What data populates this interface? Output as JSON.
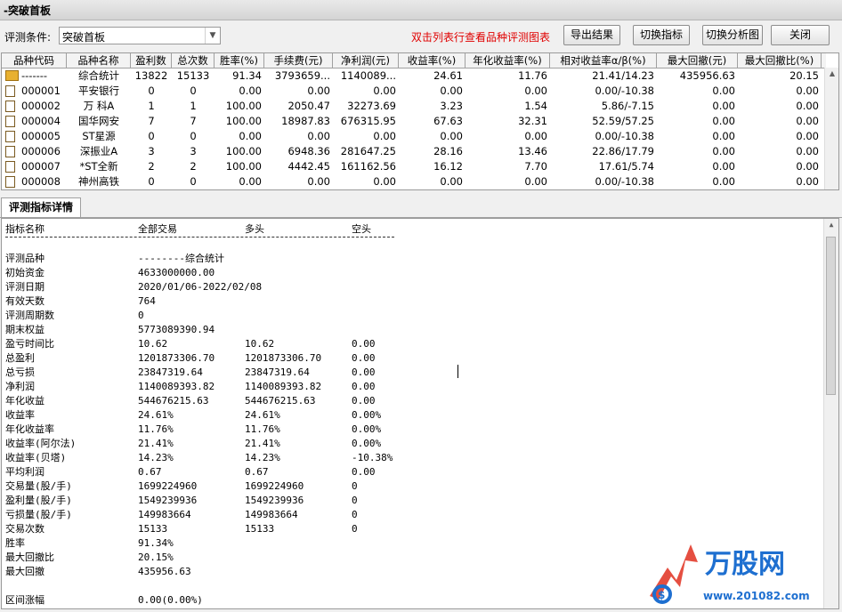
{
  "window": {
    "title": "-突破首板"
  },
  "toolbar": {
    "cond_label": "评测条件:",
    "cond_value": "突破首板",
    "hint": "双击列表行查看品种评测图表",
    "btn_export": "导出结果",
    "btn_switch_indicator": "切换指标",
    "btn_switch_chart": "切换分析图",
    "btn_close": "关闭"
  },
  "grid": {
    "headers": [
      "品种代码",
      "品种名称",
      "盈利数",
      "总次数",
      "胜率(%)",
      "手续费(元)",
      "净利润(元)",
      "收益率(%)",
      "年化收益率(%)",
      "相对收益率α/β(%)",
      "最大回撤(元)",
      "最大回撤比(%)"
    ],
    "rows": [
      {
        "icon": "folder-icon",
        "code": "-------",
        "name": "综合统计",
        "win": "13822",
        "total": "15133",
        "rate": "91.34",
        "fee": "3793659...",
        "profit": "1140089...",
        "ret": "24.61",
        "annual": "11.76",
        "ab": "21.41/14.23",
        "dd": "435956.63",
        "ddr": "20.15"
      },
      {
        "icon": "file-icon",
        "code": "000001",
        "name": "平安银行",
        "win": "0",
        "total": "0",
        "rate": "0.00",
        "fee": "0.00",
        "profit": "0.00",
        "ret": "0.00",
        "annual": "0.00",
        "ab": "0.00/-10.38",
        "dd": "0.00",
        "ddr": "0.00"
      },
      {
        "icon": "file-icon",
        "code": "000002",
        "name": "万 科A",
        "win": "1",
        "total": "1",
        "rate": "100.00",
        "fee": "2050.47",
        "profit": "32273.69",
        "ret": "3.23",
        "annual": "1.54",
        "ab": "5.86/-7.15",
        "dd": "0.00",
        "ddr": "0.00"
      },
      {
        "icon": "file-icon",
        "code": "000004",
        "name": "国华网安",
        "win": "7",
        "total": "7",
        "rate": "100.00",
        "fee": "18987.83",
        "profit": "676315.95",
        "ret": "67.63",
        "annual": "32.31",
        "ab": "52.59/57.25",
        "dd": "0.00",
        "ddr": "0.00"
      },
      {
        "icon": "file-icon",
        "code": "000005",
        "name": "ST星源",
        "win": "0",
        "total": "0",
        "rate": "0.00",
        "fee": "0.00",
        "profit": "0.00",
        "ret": "0.00",
        "annual": "0.00",
        "ab": "0.00/-10.38",
        "dd": "0.00",
        "ddr": "0.00"
      },
      {
        "icon": "file-icon",
        "code": "000006",
        "name": "深振业A",
        "win": "3",
        "total": "3",
        "rate": "100.00",
        "fee": "6948.36",
        "profit": "281647.25",
        "ret": "28.16",
        "annual": "13.46",
        "ab": "22.86/17.79",
        "dd": "0.00",
        "ddr": "0.00"
      },
      {
        "icon": "file-icon",
        "code": "000007",
        "name": "*ST全新",
        "win": "2",
        "total": "2",
        "rate": "100.00",
        "fee": "4442.45",
        "profit": "161162.56",
        "ret": "16.12",
        "annual": "7.70",
        "ab": "17.61/5.74",
        "dd": "0.00",
        "ddr": "0.00"
      },
      {
        "icon": "file-icon",
        "code": "000008",
        "name": "神州高铁",
        "win": "0",
        "total": "0",
        "rate": "0.00",
        "fee": "0.00",
        "profit": "0.00",
        "ret": "0.00",
        "annual": "0.00",
        "ab": "0.00/-10.38",
        "dd": "0.00",
        "ddr": "0.00"
      }
    ]
  },
  "detail": {
    "tab": "评测指标详情",
    "headers": [
      "指标名称",
      "全部交易",
      "多头",
      "空头"
    ],
    "rows": [
      {
        "name": "评测品种",
        "all": "--------综合统计",
        "long": "",
        "short": ""
      },
      {
        "name": "初始资金",
        "all": "4633000000.00",
        "long": "",
        "short": ""
      },
      {
        "name": "评测日期",
        "all": "2020/01/06-2022/02/08",
        "long": "",
        "short": ""
      },
      {
        "name": "有效天数",
        "all": "764",
        "long": "",
        "short": ""
      },
      {
        "name": "评测周期数",
        "all": "0",
        "long": "",
        "short": ""
      },
      {
        "name": "期末权益",
        "all": "5773089390.94",
        "long": "",
        "short": ""
      },
      {
        "name": "盈亏时间比",
        "all": "10.62",
        "long": "10.62",
        "short": "0.00"
      },
      {
        "name": "总盈利",
        "all": "1201873306.70",
        "long": "1201873306.70",
        "short": "0.00"
      },
      {
        "name": "总亏损",
        "all": "23847319.64",
        "long": "23847319.64",
        "short": "0.00"
      },
      {
        "name": "净利润",
        "all": "1140089393.82",
        "long": "1140089393.82",
        "short": "0.00"
      },
      {
        "name": "年化收益",
        "all": "544676215.63",
        "long": "544676215.63",
        "short": "0.00"
      },
      {
        "name": "收益率",
        "all": "24.61%",
        "long": "24.61%",
        "short": "0.00%"
      },
      {
        "name": "年化收益率",
        "all": "11.76%",
        "long": "11.76%",
        "short": "0.00%"
      },
      {
        "name": "收益率(阿尔法)",
        "all": "21.41%",
        "long": "21.41%",
        "short": "0.00%"
      },
      {
        "name": "收益率(贝塔)",
        "all": "14.23%",
        "long": "14.23%",
        "short": "-10.38%"
      },
      {
        "name": "平均利润",
        "all": "0.67",
        "long": "0.67",
        "short": "0.00"
      },
      {
        "name": "交易量(股/手)",
        "all": "1699224960",
        "long": "1699224960",
        "short": "0"
      },
      {
        "name": "盈利量(股/手)",
        "all": "1549239936",
        "long": "1549239936",
        "short": "0"
      },
      {
        "name": "亏损量(股/手)",
        "all": "149983664",
        "long": "149983664",
        "short": "0"
      },
      {
        "name": "交易次数",
        "all": "15133",
        "long": "15133",
        "short": "0"
      },
      {
        "name": "胜率",
        "all": "91.34%",
        "long": "",
        "short": ""
      },
      {
        "name": "最大回撤比",
        "all": "20.15%",
        "long": "",
        "short": ""
      },
      {
        "name": "最大回撤",
        "all": "435956.63",
        "long": "",
        "short": ""
      },
      {
        "name": "",
        "all": "",
        "long": "",
        "short": ""
      },
      {
        "name": "区间涨幅",
        "all": "0.00(0.00%)",
        "long": "",
        "short": ""
      }
    ]
  },
  "watermark": {
    "brand": "万股网",
    "url": "www.201082.com"
  },
  "colors": {
    "hint": "#e00000",
    "brand_blue": "#1e6fd0",
    "brand_red": "#e03020"
  }
}
